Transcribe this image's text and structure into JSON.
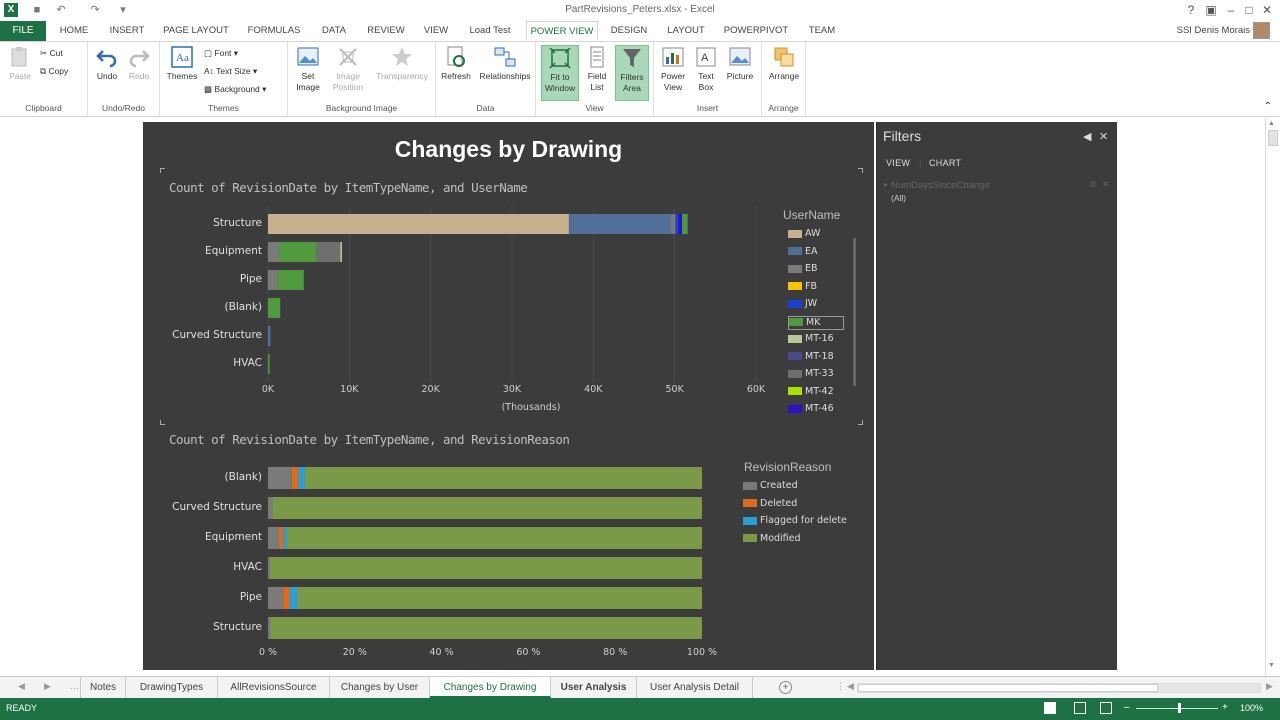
{
  "window": {
    "title": "PartRevisions_Peters.xlsx - Excel",
    "help": "?",
    "user": "SSI Denis Morais"
  },
  "ribbon_tabs": [
    "FILE",
    "HOME",
    "INSERT",
    "PAGE LAYOUT",
    "FORMULAS",
    "DATA",
    "REVIEW",
    "VIEW",
    "Load Test",
    "POWER VIEW",
    "DESIGN",
    "LAYOUT",
    "POWERPIVOT",
    "TEAM"
  ],
  "ribbon": {
    "clipboard": {
      "label": "Clipboard",
      "paste": "Paste",
      "cut": "Cut",
      "copy": "Copy"
    },
    "undoredo": {
      "label": "Undo/Redo",
      "undo": "Undo",
      "redo": "Redo"
    },
    "themes": {
      "label": "Themes",
      "themes": "Themes",
      "font": "Font",
      "text_size": "Text Size",
      "background": "Background"
    },
    "background_image": {
      "label": "Background Image",
      "set_image": "Set Image",
      "image_position": "Image Position",
      "transparency": "Transparency"
    },
    "data": {
      "label": "Data",
      "refresh": "Refresh",
      "relationships": "Relationships"
    },
    "view": {
      "label": "View",
      "fit": "Fit to Window",
      "field_list": "Field List",
      "filters_area": "Filters Area"
    },
    "insert": {
      "label": "Insert",
      "power_view": "Power View",
      "text_box": "Text Box",
      "picture": "Picture"
    },
    "arrange": {
      "label": "Arrange",
      "arrange": "Arrange"
    }
  },
  "view_title": "Changes by Drawing",
  "chart_data": [
    {
      "type": "bar",
      "stacked": true,
      "orientation": "horizontal",
      "title": "Count of RevisionDate by ItemTypeName, and UserName",
      "categories": [
        "Structure",
        "Equipment",
        "Pipe",
        "(Blank)",
        "Curved Structure",
        "HVAC"
      ],
      "x_ticks": [
        "0K",
        "10K",
        "20K",
        "30K",
        "40K",
        "50K",
        "60K"
      ],
      "xlim": [
        0,
        60000
      ],
      "xlabel": "(Thousands)",
      "legend_title": "UserName",
      "legend_position": "right",
      "legend": [
        {
          "name": "AW",
          "color": "#c8b08f"
        },
        {
          "name": "EA",
          "color": "#4f6e9a"
        },
        {
          "name": "EB",
          "color": "#7a7a7a"
        },
        {
          "name": "FB",
          "color": "#f2c600"
        },
        {
          "name": "JW",
          "color": "#1b3fd6"
        },
        {
          "name": "MK",
          "color": "#4e9a3c"
        },
        {
          "name": "MT-16",
          "color": "#b8c79a"
        },
        {
          "name": "MT-18",
          "color": "#4a4a8a"
        },
        {
          "name": "MT-33",
          "color": "#6e6e6e"
        },
        {
          "name": "MT-42",
          "color": "#a8e000"
        },
        {
          "name": "MT-46",
          "color": "#2a10c8"
        }
      ],
      "series": [
        {
          "name": "AW",
          "values": [
            37000,
            0,
            0,
            0,
            0,
            0
          ]
        },
        {
          "name": "EA",
          "values": [
            12500,
            0,
            0,
            0,
            300,
            0
          ]
        },
        {
          "name": "EB",
          "values": [
            600,
            1400,
            1200,
            0,
            0,
            0
          ]
        },
        {
          "name": "JW",
          "values": [
            400,
            0,
            0,
            0,
            0,
            0
          ]
        },
        {
          "name": "MT-46",
          "values": [
            400,
            0,
            0,
            0,
            0,
            0
          ]
        },
        {
          "name": "MK",
          "values": [
            700,
            4500,
            3200,
            1500,
            0,
            200
          ]
        },
        {
          "name": "MT-33",
          "values": [
            0,
            3000,
            0,
            0,
            0,
            0
          ]
        },
        {
          "name": "MT-16",
          "values": [
            0,
            200,
            0,
            0,
            0,
            0
          ]
        }
      ]
    },
    {
      "type": "bar",
      "stacked": true,
      "percent": true,
      "orientation": "horizontal",
      "title": "Count of RevisionDate by ItemTypeName, and RevisionReason",
      "categories": [
        "(Blank)",
        "Curved Structure",
        "Equipment",
        "HVAC",
        "Pipe",
        "Structure"
      ],
      "x_ticks": [
        "0 %",
        "20 %",
        "40 %",
        "60 %",
        "80 %",
        "100 %"
      ],
      "xlim": [
        0,
        100
      ],
      "legend_title": "RevisionReason",
      "legend_position": "right",
      "legend": [
        {
          "name": "Created",
          "color": "#7a7a7a"
        },
        {
          "name": "Deleted",
          "color": "#e06a1c"
        },
        {
          "name": "Flagged for delete",
          "color": "#2a9fd6"
        },
        {
          "name": "Modified",
          "color": "#7a9a48"
        }
      ],
      "series": [
        {
          "name": "Created",
          "values": [
            5.5,
            1.0,
            2.5,
            0.5,
            3.5,
            0.5
          ]
        },
        {
          "name": "Deleted",
          "values": [
            1.5,
            0,
            1.0,
            0,
            1.5,
            0
          ]
        },
        {
          "name": "Flagged for delete",
          "values": [
            1.5,
            0,
            0.8,
            0,
            1.8,
            0
          ]
        },
        {
          "name": "Modified",
          "values": [
            91.5,
            99.0,
            95.7,
            99.5,
            93.2,
            99.5
          ]
        }
      ]
    }
  ],
  "filters_pane": {
    "title": "Filters",
    "tab_view": "VIEW",
    "tab_chart": "CHART",
    "field": "NumDaysSinceChange",
    "value": "(All)"
  },
  "sheet_tabs": [
    "Notes",
    "DrawingTypes",
    "AllRevisionsSource",
    "Changes by User",
    "Changes by Drawing",
    "User Analysis",
    "User Analysis Detail"
  ],
  "active_sheet": "Changes by Drawing",
  "status": {
    "text": "READY",
    "zoom": "100%"
  }
}
